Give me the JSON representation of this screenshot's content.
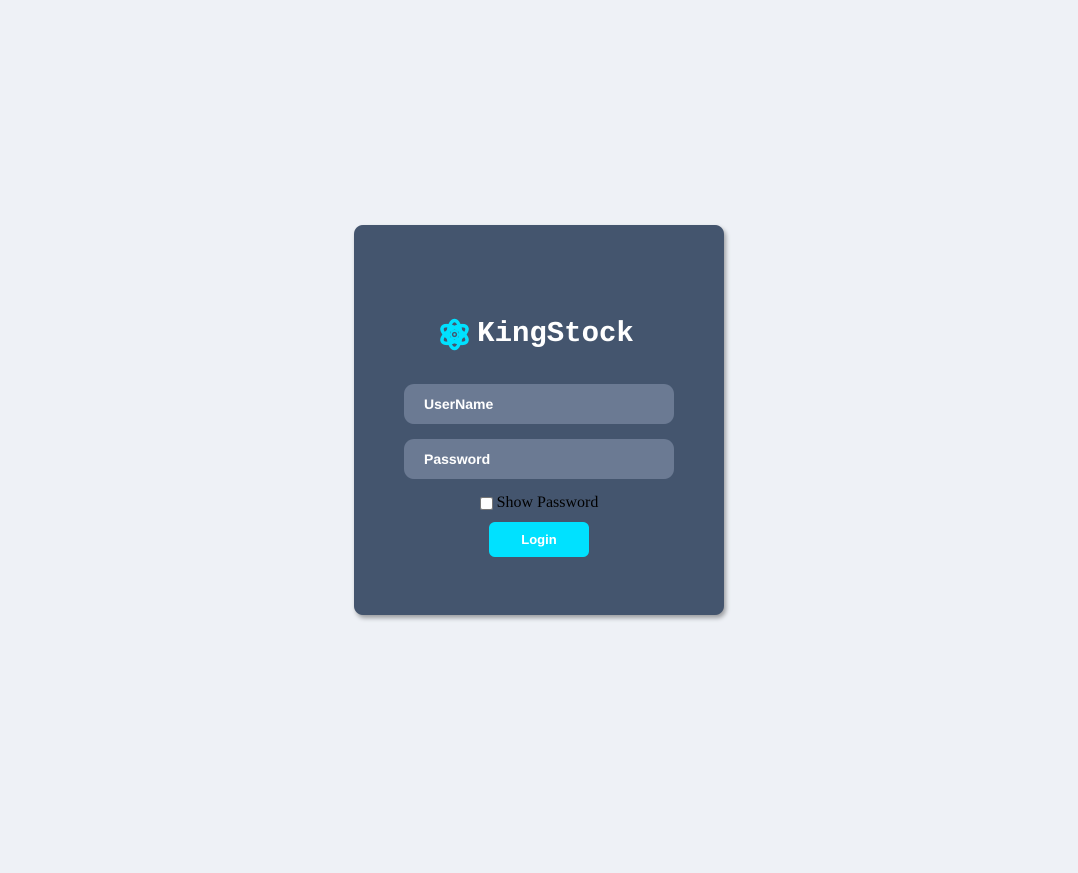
{
  "brand": {
    "name": "KingStock",
    "icon": "atom-icon",
    "icon_color": "#00e1ff"
  },
  "form": {
    "username_placeholder": "UserName",
    "username_value": "",
    "password_placeholder": "Password",
    "password_value": "",
    "show_password_label": "Show Password",
    "show_password_checked": false,
    "login_label": "Login"
  },
  "colors": {
    "page_background": "#eef1f6",
    "card_background": "#44556e",
    "input_background": "#6b7a93",
    "accent": "#00e1ff"
  }
}
